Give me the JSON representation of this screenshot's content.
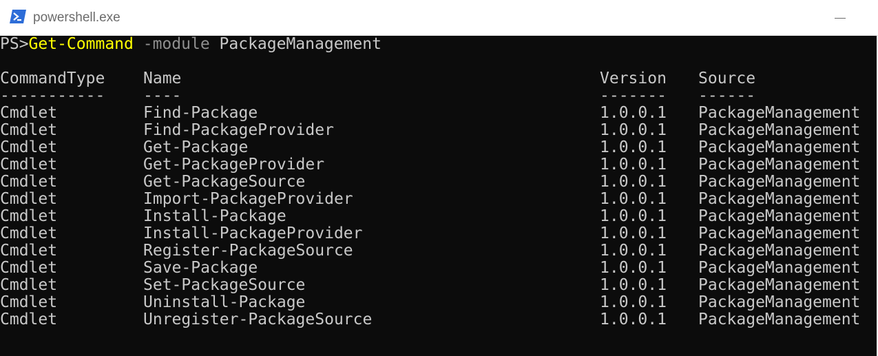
{
  "window": {
    "title": "powershell.exe",
    "icon": "powershell-icon"
  },
  "prompt": {
    "prefix": "PS>",
    "command": "Get-Command",
    "parameter": "-module",
    "argument": "PackageManagement"
  },
  "table": {
    "headers": [
      "CommandType",
      "Name",
      "Version",
      "Source"
    ],
    "underlines": [
      "-----------",
      "----",
      "-------",
      "------"
    ],
    "rows": [
      [
        "Cmdlet",
        "Find-Package",
        "1.0.0.1",
        "PackageManagement"
      ],
      [
        "Cmdlet",
        "Find-PackageProvider",
        "1.0.0.1",
        "PackageManagement"
      ],
      [
        "Cmdlet",
        "Get-Package",
        "1.0.0.1",
        "PackageManagement"
      ],
      [
        "Cmdlet",
        "Get-PackageProvider",
        "1.0.0.1",
        "PackageManagement"
      ],
      [
        "Cmdlet",
        "Get-PackageSource",
        "1.0.0.1",
        "PackageManagement"
      ],
      [
        "Cmdlet",
        "Import-PackageProvider",
        "1.0.0.1",
        "PackageManagement"
      ],
      [
        "Cmdlet",
        "Install-Package",
        "1.0.0.1",
        "PackageManagement"
      ],
      [
        "Cmdlet",
        "Install-PackageProvider",
        "1.0.0.1",
        "PackageManagement"
      ],
      [
        "Cmdlet",
        "Register-PackageSource",
        "1.0.0.1",
        "PackageManagement"
      ],
      [
        "Cmdlet",
        "Save-Package",
        "1.0.0.1",
        "PackageManagement"
      ],
      [
        "Cmdlet",
        "Set-PackageSource",
        "1.0.0.1",
        "PackageManagement"
      ],
      [
        "Cmdlet",
        "Uninstall-Package",
        "1.0.0.1",
        "PackageManagement"
      ],
      [
        "Cmdlet",
        "Unregister-PackageSource",
        "1.0.0.1",
        "PackageManagement"
      ]
    ]
  },
  "colors": {
    "console_background": "#0c0c0c",
    "console_text": "#c8c8c8",
    "command_text": "#ffff00",
    "parameter_text": "#8f8f8f",
    "titlebar_background": "#ffffff"
  }
}
